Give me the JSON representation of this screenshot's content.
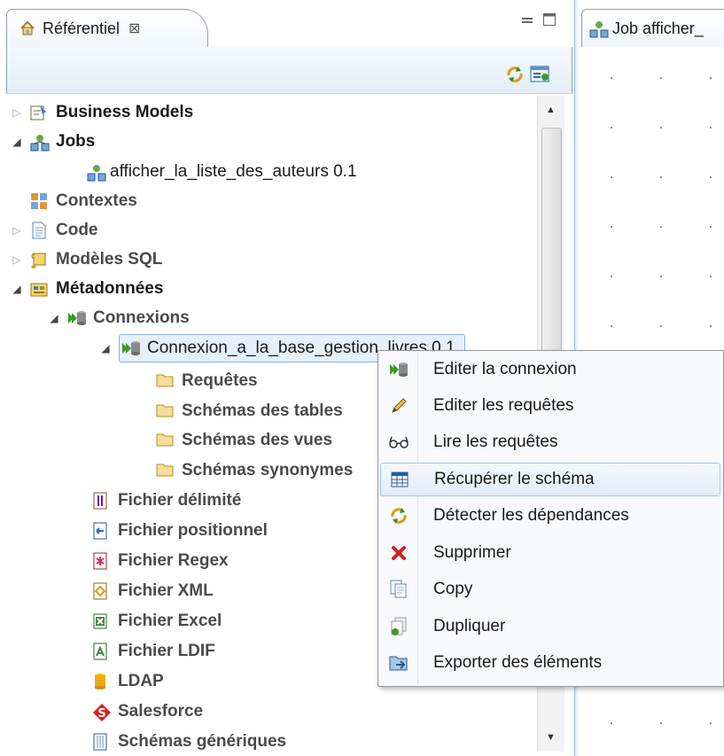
{
  "repository": {
    "tab_title": "Référentiel",
    "tab_close_glyph": "⊠",
    "tree": {
      "business_models": "Business Models",
      "jobs": "Jobs",
      "job_item": "afficher_la_liste_des_auteurs 0.1",
      "contextes": "Contextes",
      "code": "Code",
      "modeles_sql": "Modèles SQL",
      "metadonnees": "Métadonnées",
      "connexions": "Connexions",
      "connexion_item": "Connexion_a_la_base_gestion_livres 0.1",
      "requetes": "Requêtes",
      "schemas_tables": "Schémas des tables",
      "schemas_vues": "Schémas des vues",
      "schemas_synonymes": "Schémas synonymes",
      "fichier_delimite": "Fichier délimité",
      "fichier_positionnel": "Fichier positionnel",
      "fichier_regex": "Fichier Regex",
      "fichier_xml": "Fichier XML",
      "fichier_excel": "Fichier Excel",
      "fichier_ldif": "Fichier LDIF",
      "ldap": "LDAP",
      "salesforce": "Salesforce",
      "schemas_generiques": "Schémas génériques"
    }
  },
  "editor": {
    "tab_title": "Job afficher_"
  },
  "context_menu": {
    "items": [
      {
        "label": "Editer la connexion",
        "icon": "db-connection-icon"
      },
      {
        "label": "Editer les requêtes",
        "icon": "pencil-icon"
      },
      {
        "label": "Lire les requêtes",
        "icon": "glasses-icon"
      },
      {
        "label": "Récupérer le schéma",
        "icon": "table-icon"
      },
      {
        "label": "Détecter les dépendances",
        "icon": "refresh-arrows-icon"
      },
      {
        "label": "Supprimer",
        "icon": "delete-x-icon"
      },
      {
        "label": "Copy",
        "icon": "copy-icon"
      },
      {
        "label": "Dupliquer",
        "icon": "duplicate-icon"
      },
      {
        "label": "Exporter des éléments",
        "icon": "export-icon"
      }
    ],
    "hovered_index": 3
  },
  "colors": {
    "selection_bg": "#e5f0fb",
    "menu_hover_border": "#a8c4e8",
    "delete_red": "#d42020"
  }
}
